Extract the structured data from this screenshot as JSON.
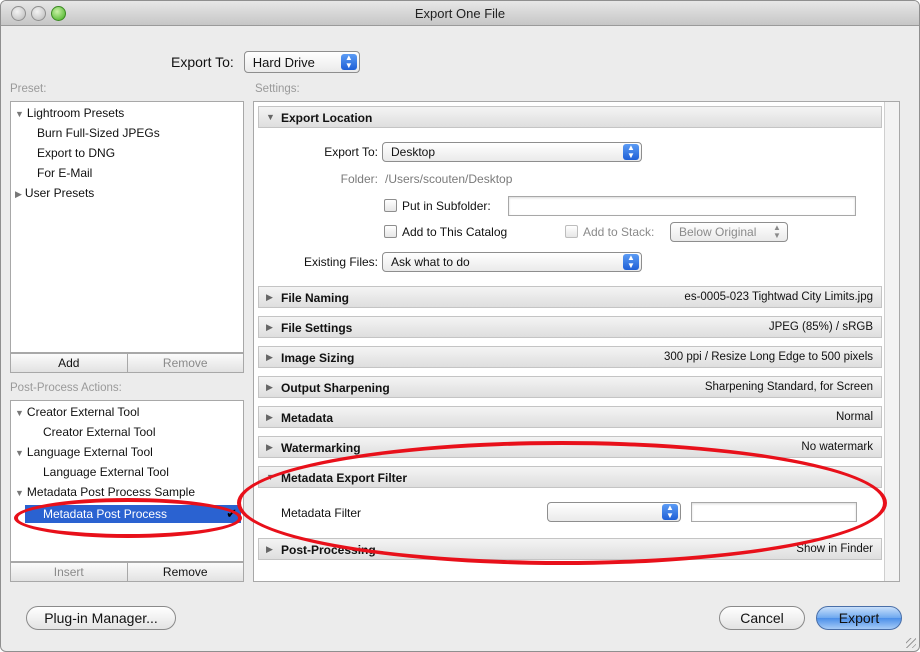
{
  "window": {
    "title": "Export One File"
  },
  "export_to": {
    "label": "Export To:",
    "value": "Hard Drive"
  },
  "preset": {
    "label": "Preset:",
    "items": [
      {
        "label": "Lightroom Presets",
        "expanded": true
      },
      {
        "label": "Burn Full-Sized JPEGs"
      },
      {
        "label": "Export to DNG"
      },
      {
        "label": "For E-Mail"
      },
      {
        "label": "User Presets",
        "expanded": false
      }
    ],
    "add_label": "Add",
    "remove_label": "Remove"
  },
  "post_process": {
    "label": "Post-Process Actions:",
    "items": [
      {
        "label": "Creator External Tool"
      },
      {
        "label": "Creator External Tool"
      },
      {
        "label": "Language External Tool"
      },
      {
        "label": "Language External Tool"
      },
      {
        "label": "Metadata Post Process Sample"
      },
      {
        "label": "Metadata Post Process",
        "selected": true,
        "check": "✔"
      }
    ],
    "insert_label": "Insert",
    "remove_label": "Remove"
  },
  "settings": {
    "label": "Settings:",
    "export_location": {
      "title": "Export Location",
      "export_to_label": "Export To:",
      "export_to_value": "Desktop",
      "folder_label": "Folder:",
      "folder_value": "/Users/scouten/Desktop",
      "subfolder_label": "Put in Subfolder:",
      "add_catalog_label": "Add to This Catalog",
      "add_stack_label": "Add to Stack:",
      "stack_value": "Below Original",
      "existing_files_label": "Existing Files:",
      "existing_files_value": "Ask what to do"
    },
    "file_naming": {
      "title": "File Naming",
      "summary": "es-0005-023 Tightwad City Limits.jpg"
    },
    "file_settings": {
      "title": "File Settings",
      "summary": "JPEG (85%) / sRGB"
    },
    "image_sizing": {
      "title": "Image Sizing",
      "summary": "300 ppi / Resize Long Edge to 500 pixels"
    },
    "output_sharpening": {
      "title": "Output Sharpening",
      "summary": "Sharpening Standard, for Screen"
    },
    "metadata": {
      "title": "Metadata",
      "summary": "Normal"
    },
    "watermarking": {
      "title": "Watermarking",
      "summary": "No watermark"
    },
    "metadata_export_filter": {
      "title": "Metadata Export Filter",
      "filter_label": "Metadata Filter"
    },
    "post_processing": {
      "title": "Post-Processing",
      "summary": "Show in Finder"
    }
  },
  "buttons": {
    "plugin_manager": "Plug-in Manager...",
    "cancel": "Cancel",
    "export": "Export"
  },
  "colors": {
    "annotation": "#e8101a",
    "selection": "#2a62d1"
  }
}
